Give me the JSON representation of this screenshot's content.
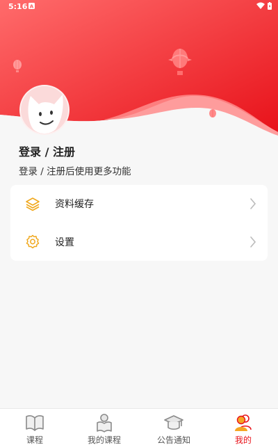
{
  "status_bar": {
    "time": "5:16",
    "notification_icon": "a-notification-icon",
    "wifi_icon": "wifi-icon",
    "battery_icon": "battery-charging-icon"
  },
  "header": {
    "gradient_colors": [
      "#ff5a5f",
      "#e8121a"
    ],
    "wave_color": "#ff8a8a",
    "avatar_icon": "cartoon-cat-avatar"
  },
  "user": {
    "login_title": "登录 / 注册",
    "login_subtitle": "登录 / 注册后使用更多功能"
  },
  "menu": {
    "items": [
      {
        "label": "资料缓存",
        "icon": "layers-icon"
      },
      {
        "label": "设置",
        "icon": "gear-icon"
      }
    ],
    "icon_color": "#f0a81d"
  },
  "tab_bar": {
    "tabs": [
      {
        "label": "课程",
        "icon": "book-icon",
        "active": false
      },
      {
        "label": "我的课程",
        "icon": "reader-icon",
        "active": false
      },
      {
        "label": "公告通知",
        "icon": "graduation-cap-icon",
        "active": false
      },
      {
        "label": "我的",
        "icon": "users-icon",
        "active": true
      }
    ],
    "active_color": "#e8121a",
    "inactive_color": "#8a8a8a"
  }
}
